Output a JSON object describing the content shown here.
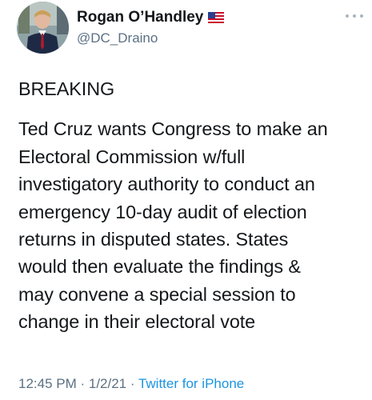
{
  "author": {
    "display_name": "Rogan O’Handley",
    "flag_icon": "us-flag-icon",
    "handle": "@DC_Draino"
  },
  "menu": {
    "icon": "more-options-icon"
  },
  "tweet": {
    "lines_1": [
      "BREAKING"
    ],
    "lines_2": [
      "Ted Cruz wants Congress to make an",
      "Electoral Commission w/full",
      "investigatory authority to conduct an",
      "emergency 10-day audit of election",
      "returns in disputed states. States",
      "would then evaluate the findings &",
      "may convene a special session to",
      "change in their electoral vote"
    ]
  },
  "meta": {
    "time": "12:45 PM",
    "date": "1/2/21",
    "separator": " · ",
    "source": "Twitter for iPhone"
  },
  "colors": {
    "text": "#14171a",
    "secondary": "#5b7083",
    "link": "#1b95e0"
  }
}
